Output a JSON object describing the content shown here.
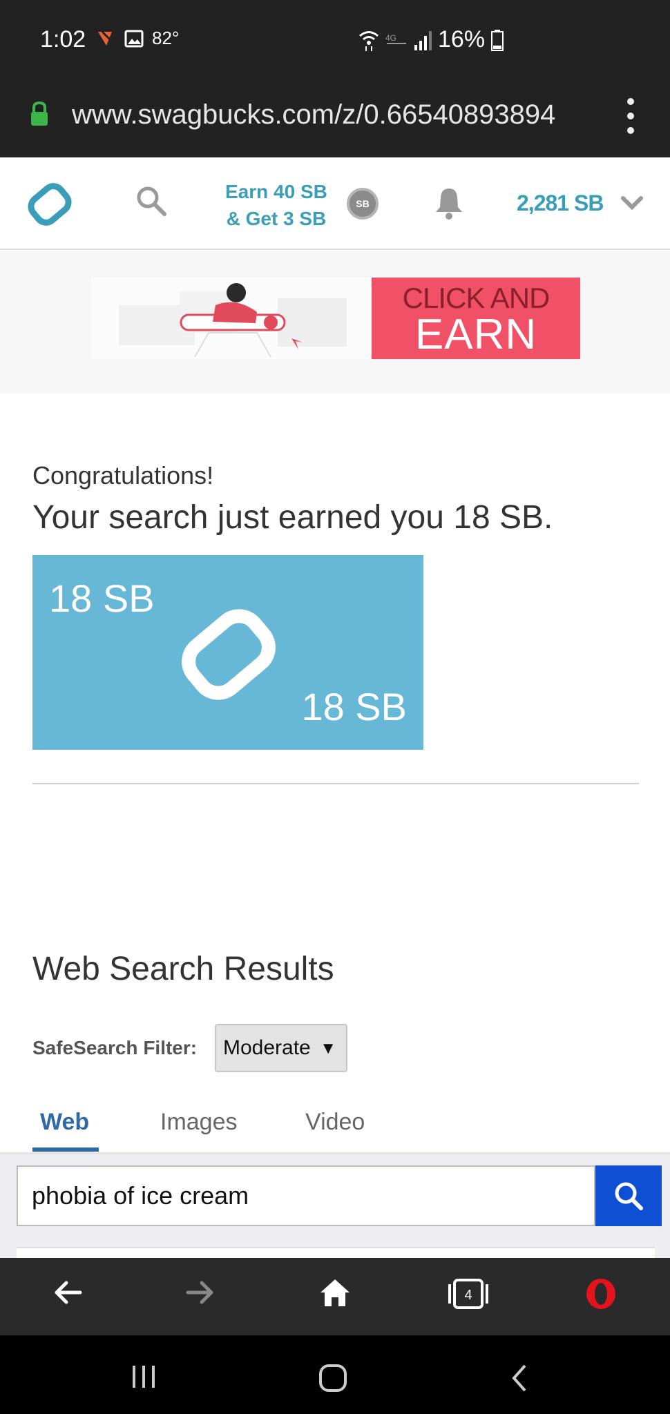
{
  "status_bar": {
    "time": "1:02",
    "temperature": "82°",
    "battery": "16%"
  },
  "url_bar": {
    "url": "www.swagbucks.com/z/0.66540893894"
  },
  "header": {
    "promo_line1": "Earn 40 SB",
    "promo_line2": "& Get 3 SB",
    "coin_label": "SB",
    "balance": "2,281 SB"
  },
  "banner": {
    "cta_line1": "CLICK AND",
    "cta_line2": "EARN"
  },
  "reward": {
    "congrats": "Congratulations!",
    "message": "Your search just earned you 18 SB.",
    "card_top_left": "18 SB",
    "card_bottom_right": "18 SB"
  },
  "results": {
    "title": "Web Search Results",
    "safesearch_label": "SafeSearch Filter:",
    "safesearch_value": "Moderate",
    "tabs": [
      {
        "label": "Web",
        "active": true
      },
      {
        "label": "Images",
        "active": false
      },
      {
        "label": "Video",
        "active": false
      }
    ],
    "search_value": "phobia of ice cream"
  },
  "browser_bar": {
    "tab_count": "4"
  },
  "colors": {
    "brand": "#3a9eba",
    "card": "#67b7d6",
    "search_button": "#0e4fd4",
    "cta": "#f05166"
  }
}
